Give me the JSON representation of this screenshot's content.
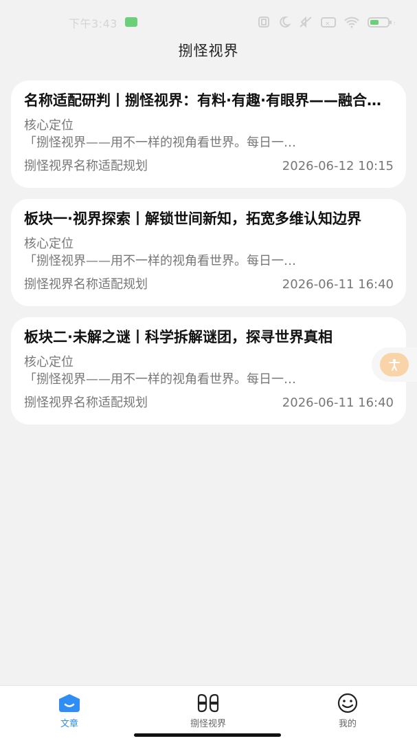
{
  "status_bar": {
    "time": "下午3:43",
    "battery": "40"
  },
  "header": {
    "title": "捌怪视界"
  },
  "articles": [
    {
      "title": "名称适配研判丨捌怪视界：有料·有趣·有眼界——融合三大风格的全能型科普认知号",
      "sub1": "核心定位",
      "sub2": "「捌怪视界——用不一样的视角看世界。每日一…",
      "source": "捌怪视界名称适配规划",
      "time": "2026-06-12 10:15"
    },
    {
      "title": "板块一·视界探索丨解锁世间新知，拓宽多维认知边界",
      "sub1": "核心定位",
      "sub2": "「捌怪视界——用不一样的视角看世界。每日一…",
      "source": "捌怪视界名称适配规划",
      "time": "2026-06-11 16:40"
    },
    {
      "title": "板块二·未解之谜丨科学拆解谜团，探寻世界真相",
      "sub1": "核心定位",
      "sub2": "「捌怪视界——用不一样的视角看世界。每日一…",
      "source": "捌怪视界名称适配规划",
      "time": "2026-06-11 16:40"
    }
  ],
  "tabs": [
    {
      "label": "文章",
      "icon": "article-icon",
      "active": true
    },
    {
      "label": "捌怪视界",
      "icon": "grid-icon",
      "active": false
    },
    {
      "label": "我的",
      "icon": "smiley-icon",
      "active": false
    }
  ],
  "colors": {
    "accent": "#2f8df4",
    "background": "#f2f2f2",
    "card": "#ffffff",
    "secondary_text": "#777777",
    "float_button": "#f8d4a8"
  }
}
